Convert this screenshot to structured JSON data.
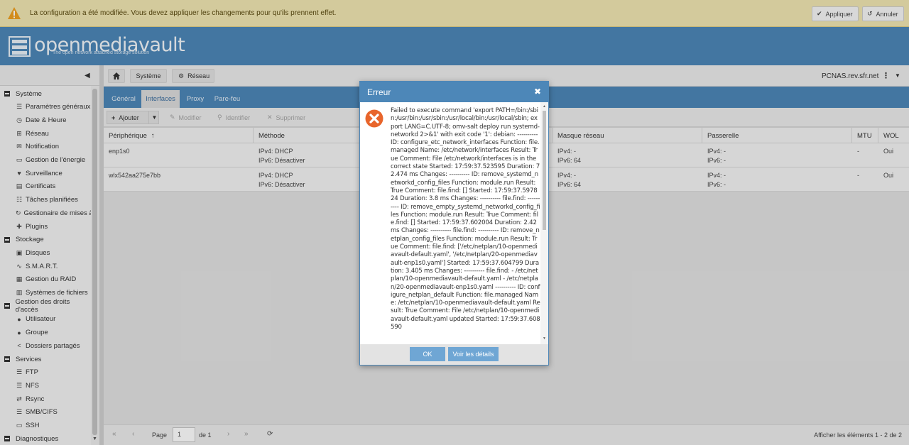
{
  "warning": {
    "message": "La configuration a été modifiée. Vous devez appliquer les changements pour qu'ils prennent effet.",
    "apply_label": "Appliquer",
    "cancel_label": "Annuler"
  },
  "header": {
    "logo_text": "openmediavault",
    "tagline": "The open network attached storage solution"
  },
  "sidebar": {
    "groups": [
      {
        "label": "Système",
        "items": [
          {
            "label": "Paramètres généraux",
            "icon": "sliders-icon"
          },
          {
            "label": "Date & Heure",
            "icon": "clock-icon"
          },
          {
            "label": "Réseau",
            "icon": "network-icon"
          },
          {
            "label": "Notification",
            "icon": "envelope-icon"
          },
          {
            "label": "Gestion de l'énergie",
            "icon": "battery-icon"
          },
          {
            "label": "Surveillance",
            "icon": "heartbeat-icon"
          },
          {
            "label": "Certificats",
            "icon": "certificate-icon"
          },
          {
            "label": "Tâches planifiées",
            "icon": "list-icon"
          },
          {
            "label": "Gestionaire de mises à",
            "icon": "refresh-icon"
          },
          {
            "label": "Plugins",
            "icon": "puzzle-icon"
          }
        ]
      },
      {
        "label": "Stockage",
        "items": [
          {
            "label": "Disques",
            "icon": "disk-icon"
          },
          {
            "label": "S.M.A.R.T.",
            "icon": "pulse-icon"
          },
          {
            "label": "Gestion du RAID",
            "icon": "raid-icon"
          },
          {
            "label": "Systèmes de fichiers",
            "icon": "filesystem-icon"
          }
        ]
      },
      {
        "label": "Gestion des droits d'accès",
        "items": [
          {
            "label": "Utilisateur",
            "icon": "user-icon"
          },
          {
            "label": "Groupe",
            "icon": "group-icon"
          },
          {
            "label": "Dossiers partagés",
            "icon": "share-icon"
          }
        ]
      },
      {
        "label": "Services",
        "items": [
          {
            "label": "FTP",
            "icon": "ftp-icon"
          },
          {
            "label": "NFS",
            "icon": "nfs-icon"
          },
          {
            "label": "Rsync",
            "icon": "rsync-icon"
          },
          {
            "label": "SMB/CIFS",
            "icon": "smb-icon"
          },
          {
            "label": "SSH",
            "icon": "terminal-icon"
          }
        ]
      },
      {
        "label": "Diagnostiques",
        "items": []
      }
    ]
  },
  "breadcrumb": {
    "items": [
      "Système",
      "Réseau"
    ],
    "hostname": "PCNAS.rev.sfr.net"
  },
  "tabs": [
    {
      "label": "Général",
      "active": false
    },
    {
      "label": "Interfaces",
      "active": true
    },
    {
      "label": "Proxy",
      "active": false
    },
    {
      "label": "Pare-feu",
      "active": false
    }
  ],
  "toolbar": {
    "add_label": "Ajouter",
    "edit_label": "Modifier",
    "identify_label": "Identifier",
    "delete_label": "Supprimer"
  },
  "grid": {
    "columns": [
      "Périphérique",
      "Méthode",
      "Masque réseau",
      "Passerelle",
      "MTU",
      "WOL"
    ],
    "sort_indicator": "↑",
    "rows": [
      {
        "device": "enp1s0",
        "method": [
          "IPv4: DHCP",
          "IPv6: Désactiver"
        ],
        "netmask": [
          "IPv4: -",
          "IPv6: 64"
        ],
        "gateway": [
          "IPv4: -",
          "IPv6: -"
        ],
        "mtu": "-",
        "wol": "Oui"
      },
      {
        "device": "wlx542aa275e7bb",
        "method": [
          "IPv4: DHCP",
          "IPv6: Désactiver"
        ],
        "netmask": [
          "IPv4: -",
          "IPv6: 64"
        ],
        "gateway": [
          "IPv4: -",
          "IPv6: -"
        ],
        "mtu": "-",
        "wol": "Oui"
      }
    ]
  },
  "pager": {
    "page_label": "Page",
    "page_value": "1",
    "of_label": "de 1",
    "display_text": "Afficher les éléments 1 - 2 de 2"
  },
  "dialog": {
    "title": "Erreur",
    "message": "Failed to execute command 'export PATH=/bin:/sbin:/usr/bin:/usr/sbin:/usr/local/bin:/usr/local/sbin; export LANG=C.UTF-8; omv-salt deploy run systemd-networkd 2>&1' with exit code '1': debian: ---------- ID: configure_etc_network_interfaces Function: file.managed Name: /etc/network/interfaces Result: True Comment: File /etc/network/interfaces is in the correct state Started: 17:59:37.523595 Duration: 72.474 ms Changes: ---------- ID: remove_systemd_networkd_config_files Function: module.run Result: True Comment: file.find: [] Started: 17:59:37.597824 Duration: 3.8 ms Changes: ---------- file.find: ---------- ID: remove_empty_systemd_networkd_config_files Function: module.run Result: True Comment: file.find: [] Started: 17:59:37.602004 Duration: 2.42 ms Changes: ---------- file.find: ---------- ID: remove_netplan_config_files Function: module.run Result: True Comment: file.find: ['/etc/netplan/10-openmediavault-default.yaml', '/etc/netplan/20-openmediavault-enp1s0.yaml'] Started: 17:59:37.604799 Duration: 3.405 ms Changes: ---------- file.find: - /etc/netplan/10-openmediavault-default.yaml - /etc/netplan/20-openmediavault-enp1s0.yaml ---------- ID: configure_netplan_default Function: file.managed Name: /etc/netplan/10-openmediavault-default.yaml Result: True Comment: File /etc/netplan/10-openmediavault-default.yaml updated Started: 17:59:37.608590",
    "ok_label": "OK",
    "details_label": "Voir les détails",
    "error_color": "#e8652b"
  }
}
